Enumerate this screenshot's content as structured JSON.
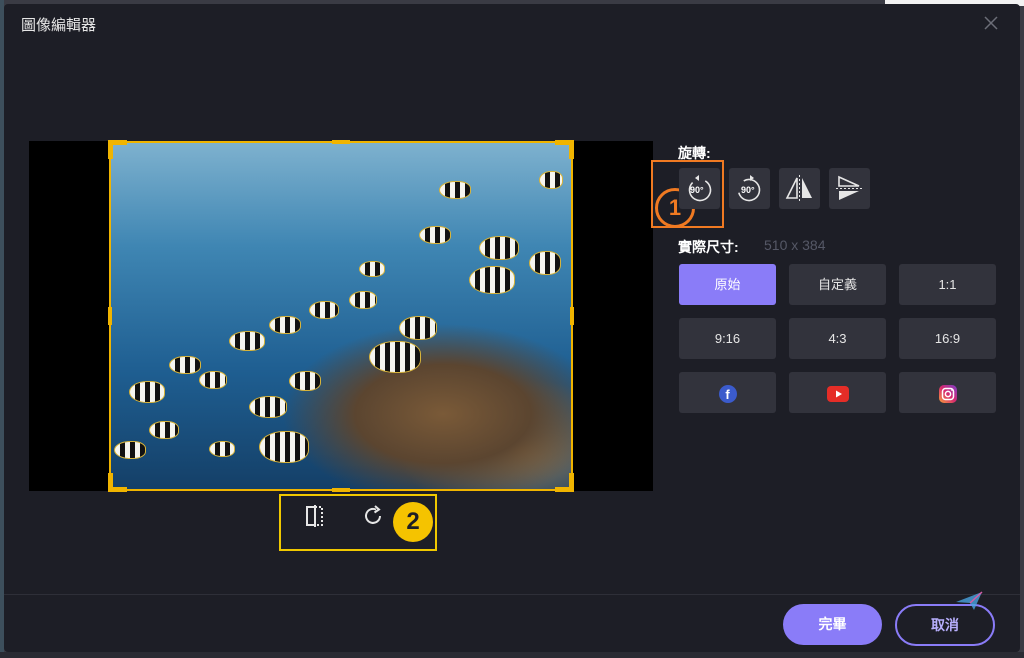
{
  "dialog": {
    "title": "圖像編輯器"
  },
  "rotate": {
    "label": "旋轉:",
    "rotate_left_text": "90°",
    "rotate_right_text": "90°"
  },
  "dimensions": {
    "label": "實際尺寸:",
    "value": "510 x 384"
  },
  "ratios": [
    {
      "label": "原始",
      "active": true
    },
    {
      "label": "自定義",
      "active": false
    },
    {
      "label": "1:1",
      "active": false
    },
    {
      "label": "9:16",
      "active": false
    },
    {
      "label": "4:3",
      "active": false
    },
    {
      "label": "16:9",
      "active": false
    }
  ],
  "social": {
    "facebook_letter": "f",
    "facebook_color": "#3b5bcc",
    "youtube_color": "#e52d27",
    "instagram_color": "#d6296f"
  },
  "annotations": {
    "badge_1": "1",
    "badge_2": "2",
    "badge_1_color": "#f07a22",
    "badge_2_color": "#f5c300"
  },
  "footer": {
    "done_label": "完畢",
    "cancel_label": "取消"
  },
  "colors": {
    "accent": "#8a7cf8",
    "crop_frame": "#f0b400",
    "dialog_bg": "#1d1e26",
    "button_bg": "#32333c"
  }
}
